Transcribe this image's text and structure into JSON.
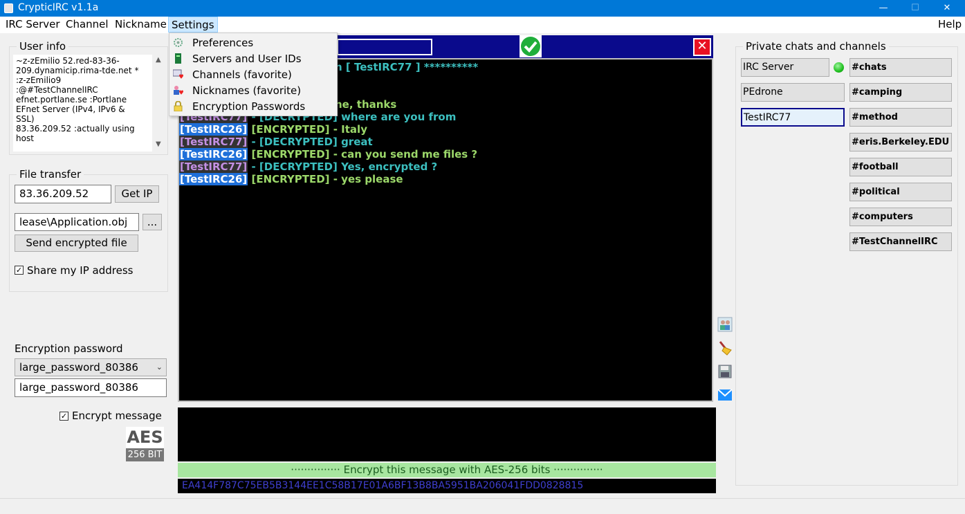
{
  "window": {
    "title": "CrypticIRC v1.1a",
    "minimize": "—",
    "maximize": "☐",
    "close": "✕"
  },
  "menubar": {
    "irc_server": "IRC Server",
    "channel": "Channel",
    "nickname": "Nickname",
    "settings": "Settings",
    "help": "Help"
  },
  "settings_menu": {
    "items": [
      "Preferences",
      "Servers and User IDs",
      "Channels (favorite)",
      "Nicknames (favorite)",
      "Encryption Passwords"
    ]
  },
  "user_info": {
    "title": "User info",
    "lines": [
      " ~z-zEmilio 52.red-83-36-",
      "209.dynamicip.rima-tde.net *",
      " :z-zEmilio9",
      " :@#TestChannelIRC",
      " efnet.portlane.se :Portlane",
      "EFnet Server (IPv4, IPv6 &",
      "SSL)",
      " 83.36.209.52 :actually using",
      "host"
    ]
  },
  "file_transfer": {
    "title": "File transfer",
    "ip_value": "83.36.209.52",
    "get_ip_label": "Get IP",
    "file_path": "lease\\Application.obj",
    "browse_label": "...",
    "send_label": "Send encrypted file",
    "share_ip_label": "Share my IP address",
    "share_ip_check": "✓"
  },
  "encryption": {
    "label": "Encryption password",
    "selected": "large_password_80386",
    "password_value": "large_password_80386",
    "encrypt_message_label": "Encrypt message",
    "encrypt_check": "✓",
    "aes_top": "AES",
    "aes_bottom": "256 BIT"
  },
  "chat": {
    "header_partial": "n [ TestIRC77 ] **********",
    "line1_partial": "ne, thanks",
    "lines": [
      {
        "nick": "[TestIRC77]",
        "tag": " - [DECRYPTED] where are you from",
        "kind": "dec"
      },
      {
        "nick": "[TestIRC26]",
        "tag": " [ENCRYPTED] - Italy",
        "kind": "enc"
      },
      {
        "nick": "[TestIRC77]",
        "tag": " - [DECRYPTED] great",
        "kind": "dec"
      },
      {
        "nick": "[TestIRC26]",
        "tag": " [ENCRYPTED] - can you send me files ?",
        "kind": "enc"
      },
      {
        "nick": "[TestIRC77]",
        "tag": " - [DECRYPTED] Yes, encrypted ?",
        "kind": "dec"
      },
      {
        "nick": "[TestIRC26]",
        "tag": " [ENCRYPTED] - yes please",
        "kind": "enc"
      }
    ],
    "close_glyph": "✕",
    "banner": "··············· Encrypt this message with AES-256 bits ···············",
    "hash": "EA414F787C75EB5B3144EE1C58B17E01A6BF13B8BA5951BA206041FDD0828815"
  },
  "private_chats": {
    "title": "Private chats and channels",
    "left_tabs": [
      "IRC Server",
      "PEdrone",
      "TestIRC77"
    ],
    "channels": [
      "#chats",
      "#camping",
      "#method",
      "#eris.Berkeley.EDU",
      "#football",
      "#political",
      "#computers",
      "#TestChannelIRC"
    ]
  }
}
